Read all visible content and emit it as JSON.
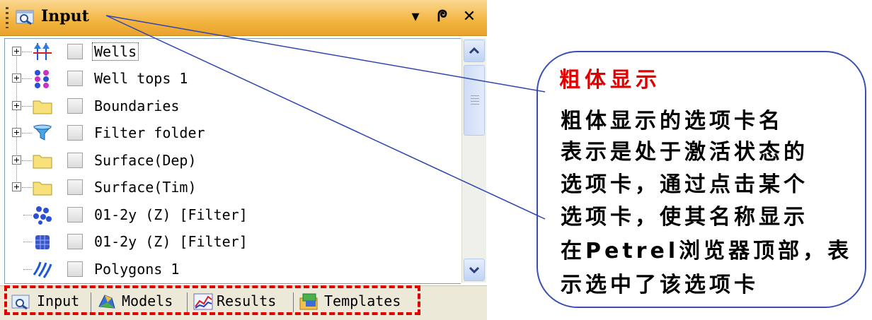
{
  "panel": {
    "title": "Input",
    "buttons": {
      "dropdown": "▾",
      "pin": "ᖘ",
      "close": "✕"
    }
  },
  "tree": {
    "items": [
      {
        "label": "Wells",
        "expandable": true,
        "icon": "wells-icon",
        "selected": true
      },
      {
        "label": "Well tops 1",
        "expandable": true,
        "icon": "well-tops-icon"
      },
      {
        "label": "Boundaries",
        "expandable": true,
        "icon": "folder-icon"
      },
      {
        "label": "Filter folder",
        "expandable": true,
        "icon": "filter-folder-icon"
      },
      {
        "label": "Surface(Dep)",
        "expandable": true,
        "icon": "folder-icon"
      },
      {
        "label": "Surface(Tim)",
        "expandable": true,
        "icon": "folder-icon"
      },
      {
        "label": "01-2y (Z) [Filter]",
        "expandable": false,
        "icon": "point-set-icon"
      },
      {
        "label": "01-2y (Z) [Filter]",
        "expandable": false,
        "icon": "cube-points-icon"
      },
      {
        "label": "Polygons 1",
        "expandable": false,
        "icon": "polygons-icon"
      }
    ]
  },
  "tabs": [
    {
      "label": "Input",
      "icon": "input-tab-icon"
    },
    {
      "label": "Models",
      "icon": "models-tab-icon"
    },
    {
      "label": "Results",
      "icon": "results-tab-icon"
    },
    {
      "label": "Templates",
      "icon": "templates-tab-icon"
    }
  ],
  "callout": {
    "title": "粗体显示",
    "lines": [
      "  粗体显示的选项卡名",
      "表示是处于激活状态的",
      "选项卡，通过点击某个",
      "选项卡，使其名称显示",
      "在Petrel浏览器顶部，表",
      "示选中了该选项卡"
    ]
  },
  "colors": {
    "titlebar": "#f3b440",
    "callout_title": "#e00000",
    "callout_border": "#3a4fb6",
    "tab_highlight": "#e00000"
  }
}
